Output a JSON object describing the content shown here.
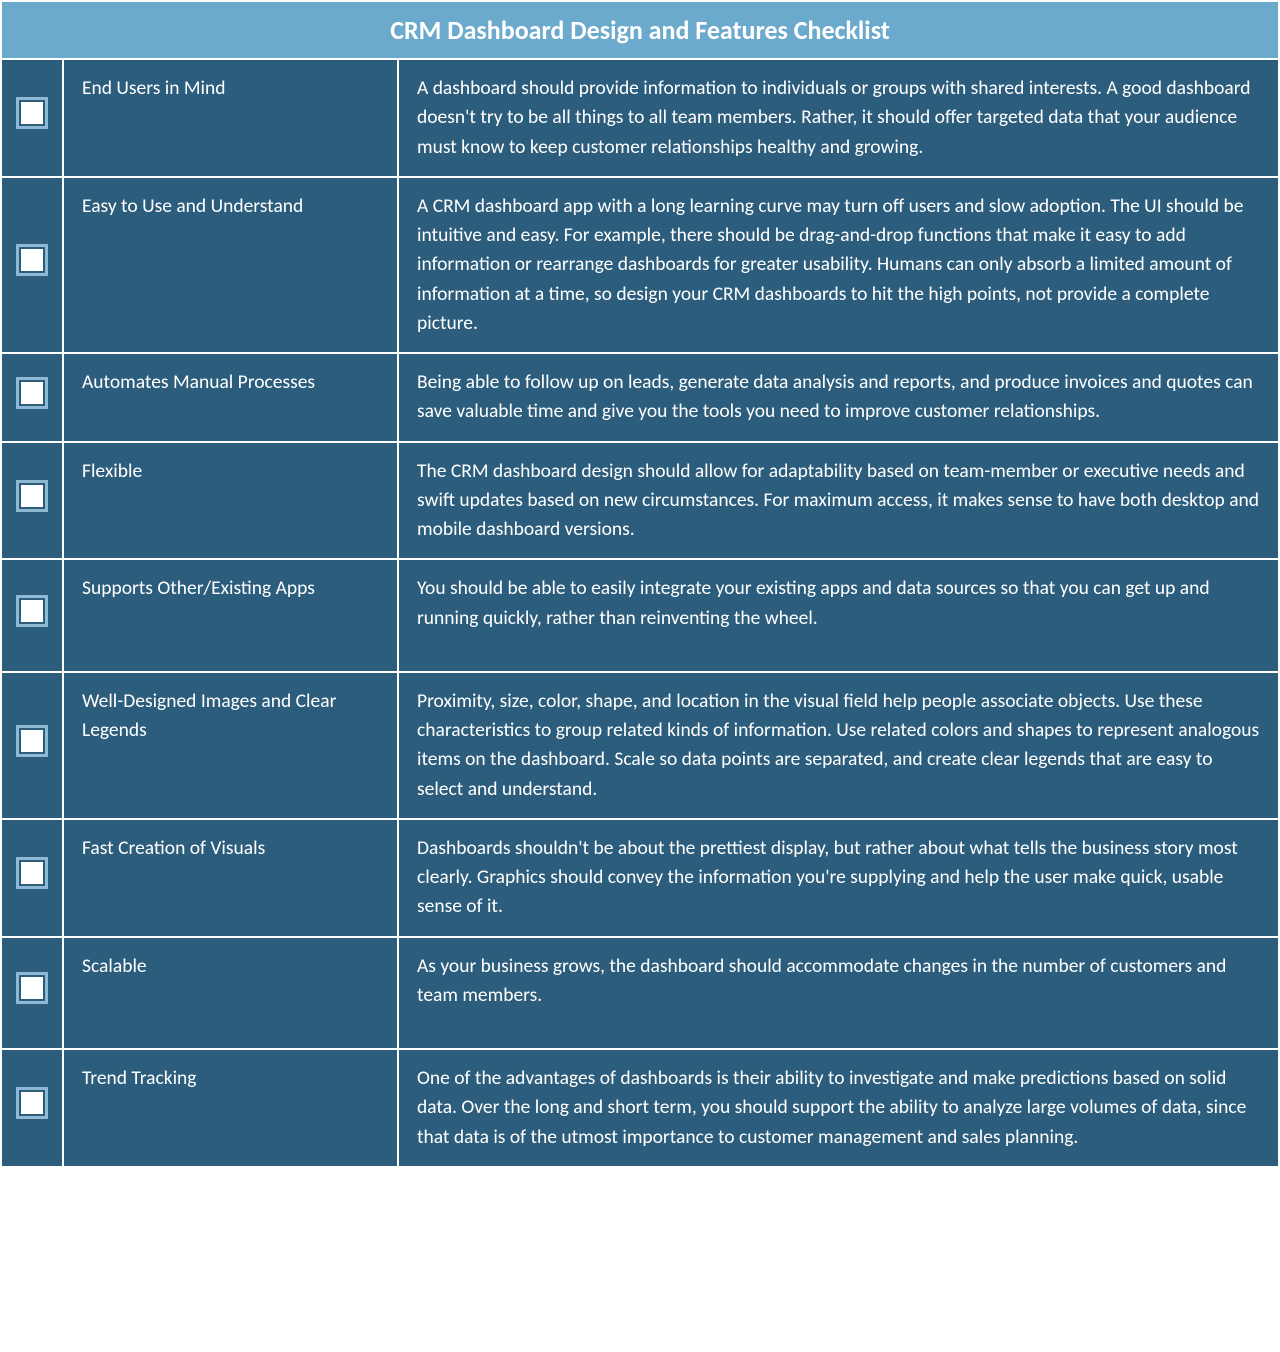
{
  "title": "CRM Dashboard Design and Features Checklist",
  "items": [
    {
      "title": "End Users in Mind",
      "description": "A dashboard should provide information to individuals or groups with shared interests. A good dashboard doesn't try to be all things to all team members. Rather, it should offer targeted data that your audience must know to keep customer relationships healthy and growing."
    },
    {
      "title": "Easy to Use and Understand",
      "description": "A CRM dashboard app with a long learning curve may turn off users and slow adoption. The UI should be intuitive and easy. For example, there should be drag-and-drop functions that make it easy to add information or rearrange dashboards for greater usability. Humans can only absorb a limited amount of information at a time, so design your CRM dashboards to hit the high points, not provide a complete picture."
    },
    {
      "title": "Automates Manual Processes",
      "description": "Being able to follow up on leads, generate data analysis and reports, and produce invoices and quotes can save valuable time and give you the tools you need to improve customer relationships."
    },
    {
      "title": "Flexible",
      "description": "The CRM dashboard design should allow for adaptability based on team-member or executive needs and swift updates based on new circumstances. For maximum access, it makes sense to have both desktop and mobile dashboard versions."
    },
    {
      "title": "Supports Other/Existing Apps",
      "description": "You should be able to easily integrate your existing apps and data sources so that you can get up and running quickly, rather than reinventing the wheel."
    },
    {
      "title": "Well-Designed Images and Clear Legends",
      "description": "Proximity, size, color, shape, and location in the visual field help people associate objects. Use these characteristics to group related kinds of information. Use related colors and shapes to represent analogous items on the dashboard. Scale so data points are separated, and create clear legends that are easy to select and understand."
    },
    {
      "title": "Fast Creation of Visuals",
      "description": "Dashboards shouldn't be about the prettiest display, but rather about what tells the business story most clearly. Graphics should convey the information you're supplying and help the user make quick, usable sense of it."
    },
    {
      "title": "Scalable",
      "description": "As your business grows, the dashboard should accommodate changes in the number of customers and team members."
    },
    {
      "title": "Trend Tracking",
      "description": "One of the advantages of dashboards is their ability to investigate and make predictions based on solid data. Over the long and short term, you should support the ability to analyze large volumes of data, since that data is of the utmost importance to customer management and sales planning."
    }
  ],
  "extraPadRows": [
    4,
    7
  ]
}
